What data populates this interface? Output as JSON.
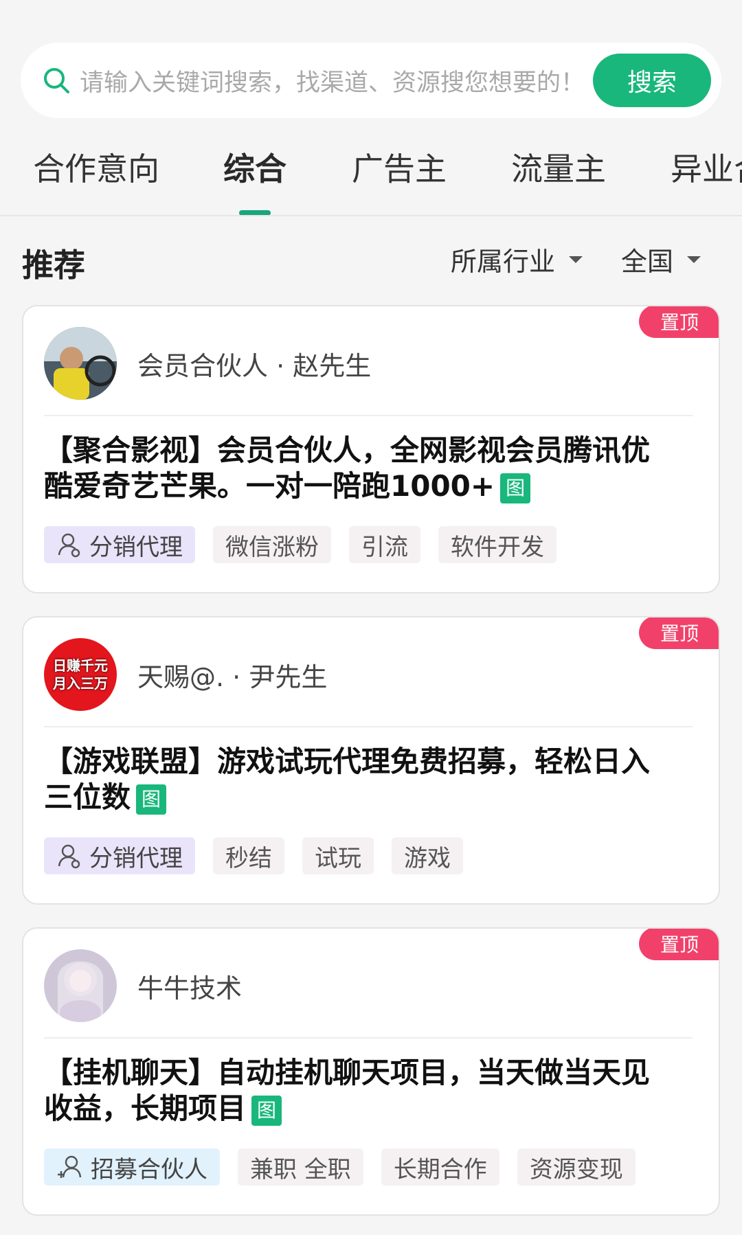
{
  "search": {
    "placeholder": "请输入关键词搜索，找渠道、资源搜您想要的！",
    "button_label": "搜索"
  },
  "tabs": [
    {
      "label": "合作意向",
      "active": false
    },
    {
      "label": "综合",
      "active": true
    },
    {
      "label": "广告主",
      "active": false
    },
    {
      "label": "流量主",
      "active": false
    },
    {
      "label": "异业合",
      "active": false
    }
  ],
  "section": {
    "title": "推荐",
    "filter_industry": "所属行业",
    "filter_region": "全国"
  },
  "colors": {
    "accent": "#19b77c",
    "pin_badge": "#f1416a"
  },
  "cards": [
    {
      "badge": "置顶",
      "author": "会员合伙人 · 赵先生",
      "title": "【聚合影视】会员合伙人，全网影视会员腾讯优酷爱奇艺芒果。一对一陪跑1000+",
      "img_badge": "图",
      "tags": [
        {
          "label": "分销代理",
          "icon": "user-agent-icon"
        },
        {
          "label": "微信涨粉"
        },
        {
          "label": "引流"
        },
        {
          "label": "软件开发"
        }
      ]
    },
    {
      "badge": "置顶",
      "author": "天赐@. · 尹先生",
      "avatar_text": "日赚千元月入三万",
      "title": "【游戏联盟】游戏试玩代理免费招募，轻松日入三位数",
      "img_badge": "图",
      "tags": [
        {
          "label": "分销代理",
          "icon": "user-agent-icon"
        },
        {
          "label": "秒结"
        },
        {
          "label": "试玩"
        },
        {
          "label": "游戏"
        }
      ]
    },
    {
      "badge": "置顶",
      "author": "牛牛技术",
      "title": "【挂机聊天】自动挂机聊天项目，当天做当天见收益，长期项目",
      "img_badge": "图",
      "tags": [
        {
          "label": "招募合伙人",
          "icon": "recruit-partner-icon"
        },
        {
          "label": "兼职 全职"
        },
        {
          "label": "长期合作"
        },
        {
          "label": "资源变现"
        }
      ]
    }
  ]
}
